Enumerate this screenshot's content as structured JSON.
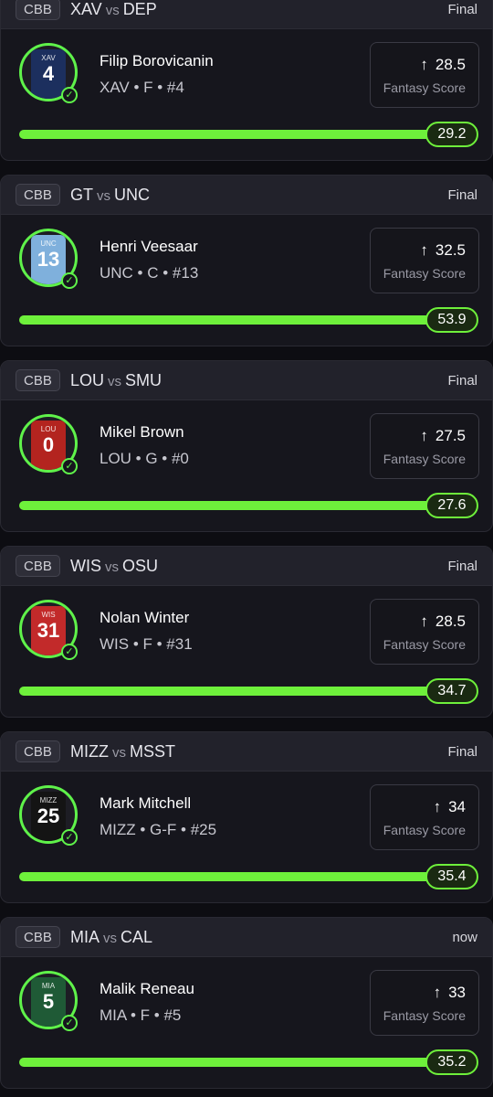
{
  "cards": [
    {
      "league": "CBB",
      "team_a": "XAV",
      "vs": "vs",
      "team_b": "DEP",
      "status": "Final",
      "player": "Filip Borovicanin",
      "meta": "XAV • F • #4",
      "jersey_team": "XAV",
      "jersey_number": "4",
      "jersey_color": "#1c2f5e",
      "line": "28.5",
      "stat_label": "Fantasy Score",
      "result": "29.2",
      "progress": 1.0
    },
    {
      "league": "CBB",
      "team_a": "GT",
      "vs": "vs",
      "team_b": "UNC",
      "status": "Final",
      "player": "Henri Veesaar",
      "meta": "UNC • C • #13",
      "jersey_team": "UNC",
      "jersey_number": "13",
      "jersey_color": "#7fb0dc",
      "line": "32.5",
      "stat_label": "Fantasy Score",
      "result": "53.9",
      "progress": 1.0
    },
    {
      "league": "CBB",
      "team_a": "LOU",
      "vs": "vs",
      "team_b": "SMU",
      "status": "Final",
      "player": "Mikel Brown",
      "meta": "LOU • G • #0",
      "jersey_team": "LOU",
      "jersey_number": "0",
      "jersey_color": "#b3241f",
      "line": "27.5",
      "stat_label": "Fantasy Score",
      "result": "27.6",
      "progress": 1.0
    },
    {
      "league": "CBB",
      "team_a": "WIS",
      "vs": "vs",
      "team_b": "OSU",
      "status": "Final",
      "player": "Nolan Winter",
      "meta": "WIS • F • #31",
      "jersey_team": "WIS",
      "jersey_number": "31",
      "jersey_color": "#c22a2a",
      "line": "28.5",
      "stat_label": "Fantasy Score",
      "result": "34.7",
      "progress": 1.0
    },
    {
      "league": "CBB",
      "team_a": "MIZZ",
      "vs": "vs",
      "team_b": "MSST",
      "status": "Final",
      "player": "Mark Mitchell",
      "meta": "MIZZ • G-F • #25",
      "jersey_team": "MIZZ",
      "jersey_number": "25",
      "jersey_color": "#141414",
      "line": "34",
      "stat_label": "Fantasy Score",
      "result": "35.4",
      "progress": 1.0
    },
    {
      "league": "CBB",
      "team_a": "MIA",
      "vs": "vs",
      "team_b": "CAL",
      "status": "now",
      "player": "Malik Reneau",
      "meta": "MIA • F • #5",
      "jersey_team": "MIA",
      "jersey_number": "5",
      "jersey_color": "#1f5a36",
      "line": "33",
      "stat_label": "Fantasy Score",
      "result": "35.2",
      "progress": 1.0
    }
  ],
  "icons": {
    "arrow": "arrow-up-icon",
    "check": "check-circle-icon"
  },
  "colors": {
    "accent": "#6ef03b",
    "card_bg": "#16161d",
    "header_bg": "#22222b",
    "page_bg": "#0d0d12"
  }
}
